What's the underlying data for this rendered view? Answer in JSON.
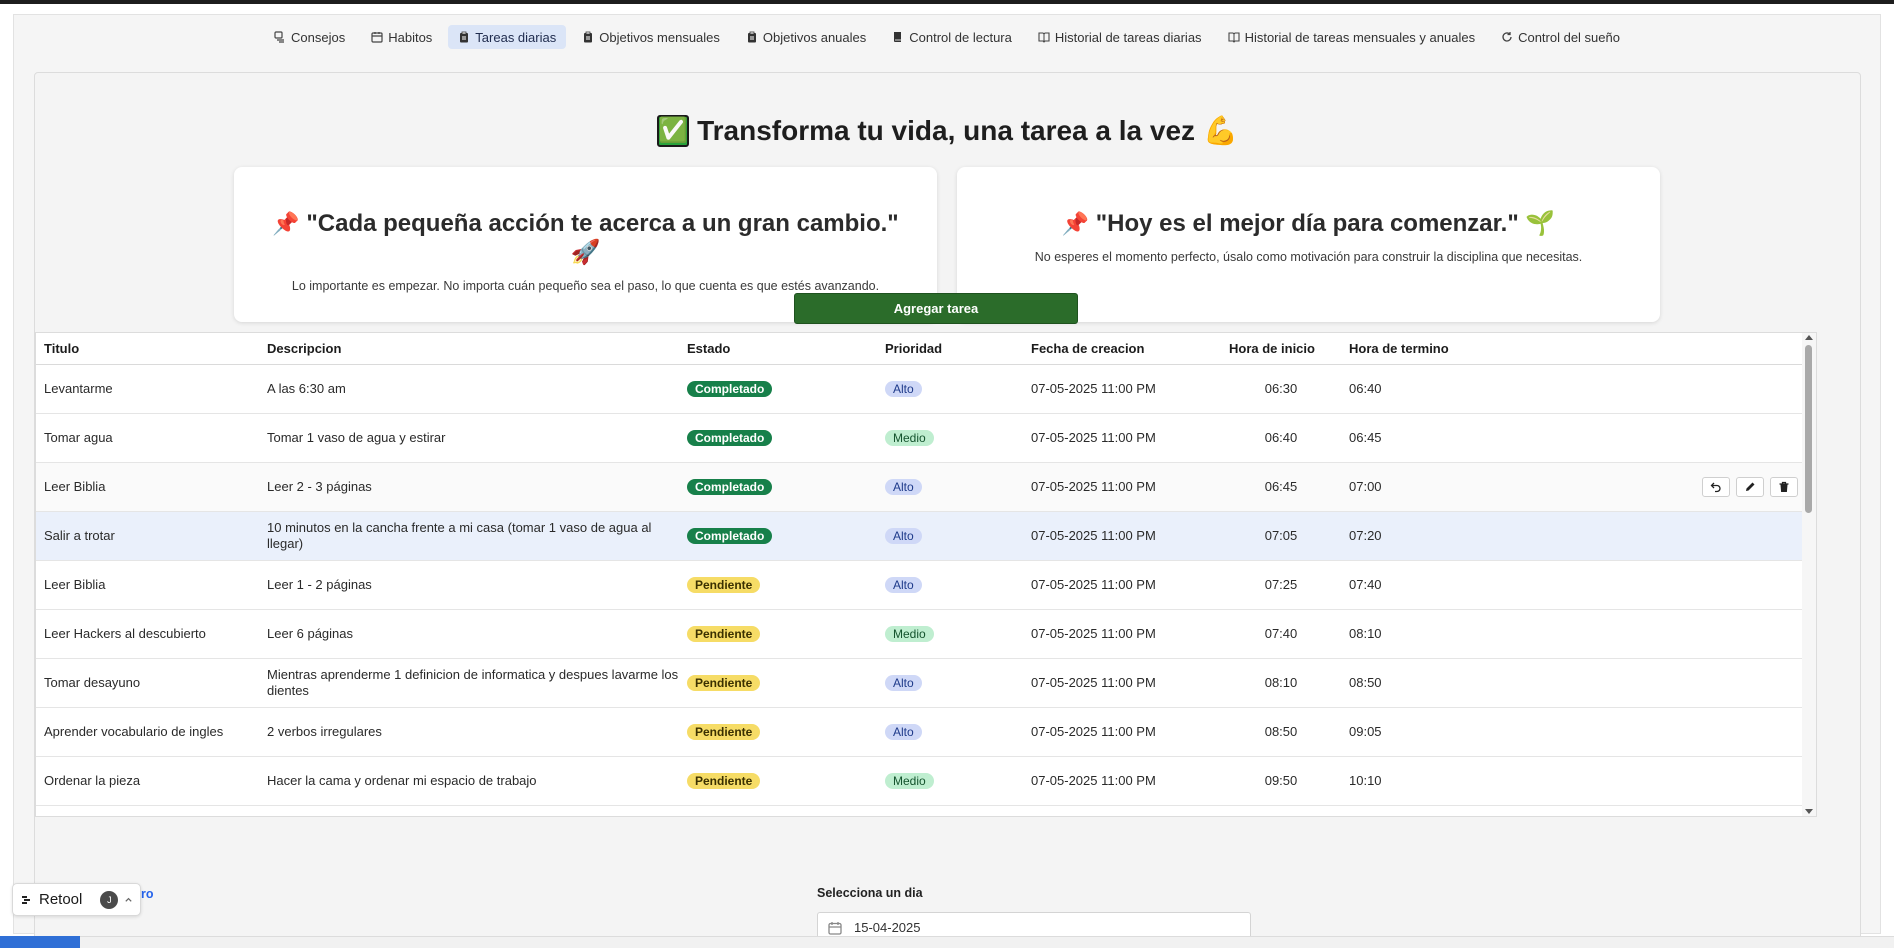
{
  "tabs": [
    {
      "label": "Consejos",
      "icon": "lightbulb-icon",
      "active": false
    },
    {
      "label": "Habitos",
      "icon": "calendar-icon",
      "active": false
    },
    {
      "label": "Tareas diarias",
      "icon": "clipboard-icon",
      "active": true
    },
    {
      "label": "Objetivos mensuales",
      "icon": "clipboard-icon",
      "active": false
    },
    {
      "label": "Objetivos anuales",
      "icon": "clipboard-icon",
      "active": false
    },
    {
      "label": "Control de lectura",
      "icon": "book-icon",
      "active": false
    },
    {
      "label": "Historial de tareas diarias",
      "icon": "open-book-icon",
      "active": false
    },
    {
      "label": "Historial de tareas mensuales y anuales",
      "icon": "open-book-icon",
      "active": false
    },
    {
      "label": "Control del sueño",
      "icon": "refresh-icon",
      "active": false
    }
  ],
  "headline": {
    "text": "Transforma tu vida, una tarea a la vez",
    "emoji_start": "✅",
    "emoji_end": "💪"
  },
  "cards": [
    {
      "title": "\"Cada pequeña acción te acerca a un gran cambio.\"",
      "pin": "📌",
      "trail": "🚀",
      "body": "Lo importante es empezar. No importa cuán pequeño sea el paso, lo que cuenta es que estés avanzando."
    },
    {
      "title": "\"Hoy es el mejor día para comenzar.\"",
      "pin": "📌",
      "trail": "🌱",
      "body": "No esperes el momento perfecto, úsalo como motivación para construir la disciplina que necesitas."
    }
  ],
  "add_button": "Agregar tarea",
  "table": {
    "columns": [
      "Titulo",
      "Descripcion",
      "Estado",
      "Prioridad",
      "Fecha de creacion",
      "Hora de inicio",
      "Hora de termino"
    ],
    "rows": [
      {
        "titulo": "Levantarme",
        "descripcion": "A las 6:30 am",
        "estado": "Completado",
        "prioridad": "Alto",
        "fecha": "07-05-2025 11:00 PM",
        "inicio": "06:30",
        "termino": "06:40"
      },
      {
        "titulo": "Tomar agua",
        "descripcion": "Tomar 1 vaso de agua y estirar",
        "estado": "Completado",
        "prioridad": "Medio",
        "fecha": "07-05-2025 11:00 PM",
        "inicio": "06:40",
        "termino": "06:45"
      },
      {
        "titulo": "Leer Biblia",
        "descripcion": "Leer 2 - 3 páginas",
        "estado": "Completado",
        "prioridad": "Alto",
        "fecha": "07-05-2025 11:00 PM",
        "inicio": "06:45",
        "termino": "07:00"
      },
      {
        "titulo": "Salir a trotar",
        "descripcion": "10 minutos en la cancha frente a mi casa (tomar 1 vaso de agua al llegar)",
        "estado": "Completado",
        "prioridad": "Alto",
        "fecha": "07-05-2025 11:00 PM",
        "inicio": "07:05",
        "termino": "07:20"
      },
      {
        "titulo": "Leer Biblia",
        "descripcion": "Leer 1 - 2 páginas",
        "estado": "Pendiente",
        "prioridad": "Alto",
        "fecha": "07-05-2025 11:00 PM",
        "inicio": "07:25",
        "termino": "07:40"
      },
      {
        "titulo": "Leer Hackers al descubierto",
        "descripcion": "Leer 6 páginas",
        "estado": "Pendiente",
        "prioridad": "Medio",
        "fecha": "07-05-2025 11:00 PM",
        "inicio": "07:40",
        "termino": "08:10"
      },
      {
        "titulo": "Tomar desayuno",
        "descripcion": "Mientras aprenderme 1 definicion de informatica y despues lavarme los dientes",
        "estado": "Pendiente",
        "prioridad": "Alto",
        "fecha": "07-05-2025 11:00 PM",
        "inicio": "08:10",
        "termino": "08:50"
      },
      {
        "titulo": "Aprender vocabulario de ingles",
        "descripcion": "2 verbos irregulares",
        "estado": "Pendiente",
        "prioridad": "Alto",
        "fecha": "07-05-2025 11:00 PM",
        "inicio": "08:50",
        "termino": "09:05"
      },
      {
        "titulo": "Ordenar la pieza",
        "descripcion": "Hacer la cama y ordenar mi espacio de trabajo",
        "estado": "Pendiente",
        "prioridad": "Medio",
        "fecha": "07-05-2025 11:00 PM",
        "inicio": "09:50",
        "termino": "10:10"
      }
    ],
    "row_actions": [
      "undo-icon",
      "pencil-icon",
      "trash-icon"
    ]
  },
  "cronometro": "Cronometro",
  "day_picker": {
    "label": "Selecciona un dia",
    "value": "15-04-2025"
  },
  "retool": {
    "label": "Retool",
    "avatar": "J"
  }
}
